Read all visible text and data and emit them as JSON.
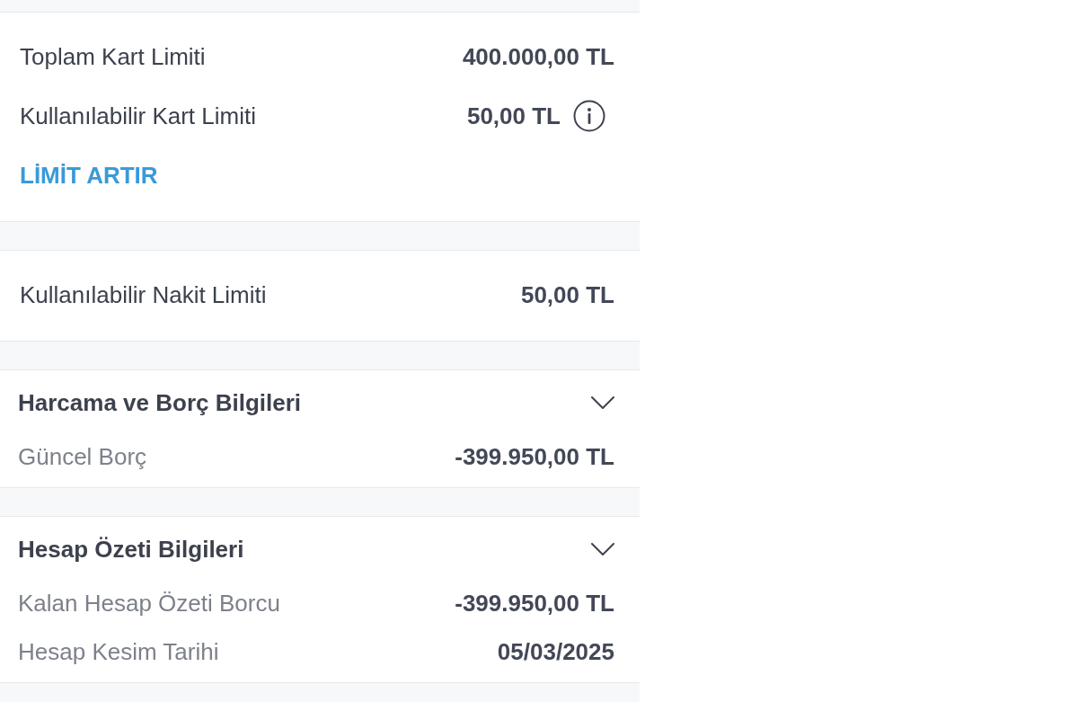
{
  "limit_card": {
    "rows": [
      {
        "label": "Toplam Kart Limiti",
        "value": "400.000,00 TL",
        "info": false
      },
      {
        "label": "Kullanılabilir Kart Limiti",
        "value": "50,00 TL",
        "info": true
      }
    ],
    "link": "LİMİT ARTIR"
  },
  "cash_card": {
    "rows": [
      {
        "label": "Kullanılabilir Nakit Limiti",
        "value": "50,00 TL",
        "info": false
      }
    ]
  },
  "sections": [
    {
      "title": "Harcama ve Borç Bilgileri",
      "rows": [
        {
          "label": "Güncel Borç",
          "value": "-399.950,00 TL"
        }
      ]
    },
    {
      "title": "Hesap Özeti Bilgileri",
      "rows": [
        {
          "label": "Kalan Hesap Özeti Borcu",
          "value": "-399.950,00 TL"
        },
        {
          "label": "Hesap Kesim Tarihi",
          "value": "05/03/2025"
        }
      ]
    }
  ]
}
